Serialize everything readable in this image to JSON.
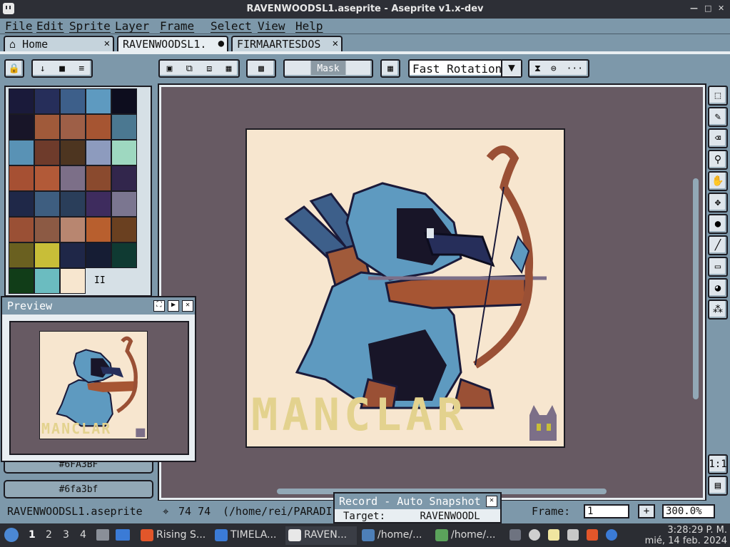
{
  "window": {
    "title": "RAVENWOODSL1.aseprite - Aseprite v1.x-dev",
    "buttons": [
      "—",
      "□",
      "✕"
    ]
  },
  "menu": [
    "File",
    "Edit",
    "Sprite",
    "Layer",
    "Frame",
    "Select",
    "View",
    "Help"
  ],
  "tabs": [
    {
      "label": "Home",
      "icon": "home-icon",
      "close": "✕"
    },
    {
      "label": "RAVENWOODSL1.",
      "active": true,
      "close": "●"
    },
    {
      "label": "FIRMAARTESDOS",
      "close": "✕"
    }
  ],
  "toolbar": {
    "mask_label": "Mask",
    "rotation_select": "Fast Rotation",
    "more": "···"
  },
  "palette": {
    "colors": [
      "#1a1a3a",
      "#262e5a",
      "#3d5f8a",
      "#5e9ac0",
      "#0d0d1e",
      "#181528",
      "#a05a3a",
      "#9e5f47",
      "#a65532",
      "#4b7891",
      "#5992b5",
      "#6e3b2b",
      "#4d3520",
      "#8d9bbe",
      "#9ed8c0",
      "#a65033",
      "#b25a38",
      "#7c6f88",
      "#8a4a2e",
      "#32264c",
      "#1f2848",
      "#3e5e80",
      "#2a3e5a",
      "#3e2c5e",
      "#7b7690",
      "#9a5035",
      "#8c5a44",
      "#b88670",
      "#b85f2e",
      "#6a4020",
      "#6a6020",
      "#c8be38",
      "#1f2748",
      "#161d34",
      "#0f3a32",
      "#113d18",
      "#6bbcc0",
      "#f7e6cf"
    ],
    "page_marker": "II"
  },
  "preview": {
    "title": "Preview",
    "logo": "MANCLAR"
  },
  "color_bars": [
    "#6FA3BF",
    "#6fa3bf"
  ],
  "canvas": {
    "logo": "MANCLAR"
  },
  "status": {
    "filename": "RAVENWOODSL1.aseprite",
    "coords": "74 74",
    "path": "(/home/rei/PARADI",
    "frame_label": "Frame:",
    "frame_value": "1",
    "zoom": "300.0%"
  },
  "record": {
    "title": "Record - Auto Snapshot",
    "target_label": "Target:",
    "target_value": "RAVENWOODL"
  },
  "taskbar": {
    "workspaces": [
      "1",
      "2",
      "3",
      "4"
    ],
    "tasks": [
      {
        "label": "Rising S...",
        "color": "#e2562a"
      },
      {
        "label": "TIMELA...",
        "color": "#3b7bd6"
      },
      {
        "label": "RAVEN...",
        "color": "#e8e8e8",
        "active": true
      },
      {
        "label": "/home/...",
        "color": "#4d7fb8"
      },
      {
        "label": "/home/...",
        "color": "#5ba35b"
      }
    ],
    "time": "3:28:29 P. M.",
    "date": "mié, 14 feb. 2024"
  }
}
